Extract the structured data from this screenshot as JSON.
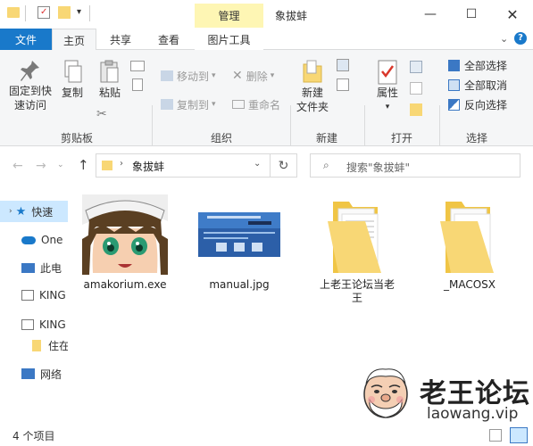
{
  "window": {
    "title": "象拔蚌",
    "context_tab": "管理"
  },
  "tabs": {
    "file": "文件",
    "home": "主页",
    "share": "共享",
    "view": "查看",
    "picture_tools": "图片工具"
  },
  "ribbon": {
    "clipboard": {
      "pin": "固定到快速访问",
      "pin_line1": "固定到快",
      "pin_line2": "速访问",
      "copy": "复制",
      "paste": "粘贴",
      "label": "剪贴板"
    },
    "organize": {
      "move_to": "移动到",
      "copy_to": "复制到",
      "delete": "删除",
      "rename": "重命名",
      "label": "组织"
    },
    "new": {
      "new_folder_line1": "新建",
      "new_folder_line2": "文件夹",
      "label": "新建"
    },
    "open": {
      "properties": "属性",
      "label": "打开"
    },
    "select": {
      "select_all": "全部选择",
      "select_none": "全部取消",
      "invert": "反向选择",
      "label": "选择"
    }
  },
  "address": {
    "path": "象拔蚌",
    "search_placeholder": "搜索\"象拔蚌\""
  },
  "nav": {
    "items": [
      "快速",
      "One",
      "此电",
      "KING",
      "KING",
      "住在",
      "网络"
    ]
  },
  "files": [
    {
      "name": "amakorium.exe",
      "type": "exe"
    },
    {
      "name": "manual.jpg",
      "type": "image"
    },
    {
      "name": "上老王论坛当老王",
      "name_line1": "上老王论坛当老",
      "name_line2": "王",
      "type": "folder"
    },
    {
      "name": "_MACOSX",
      "type": "folder"
    }
  ],
  "status": {
    "count": "4 个项目"
  },
  "watermark": {
    "title": "老王论坛",
    "url": "laowang.vip"
  },
  "colors": {
    "accent": "#1979ca",
    "context": "#fef6b4",
    "folder": "#f8d775"
  }
}
